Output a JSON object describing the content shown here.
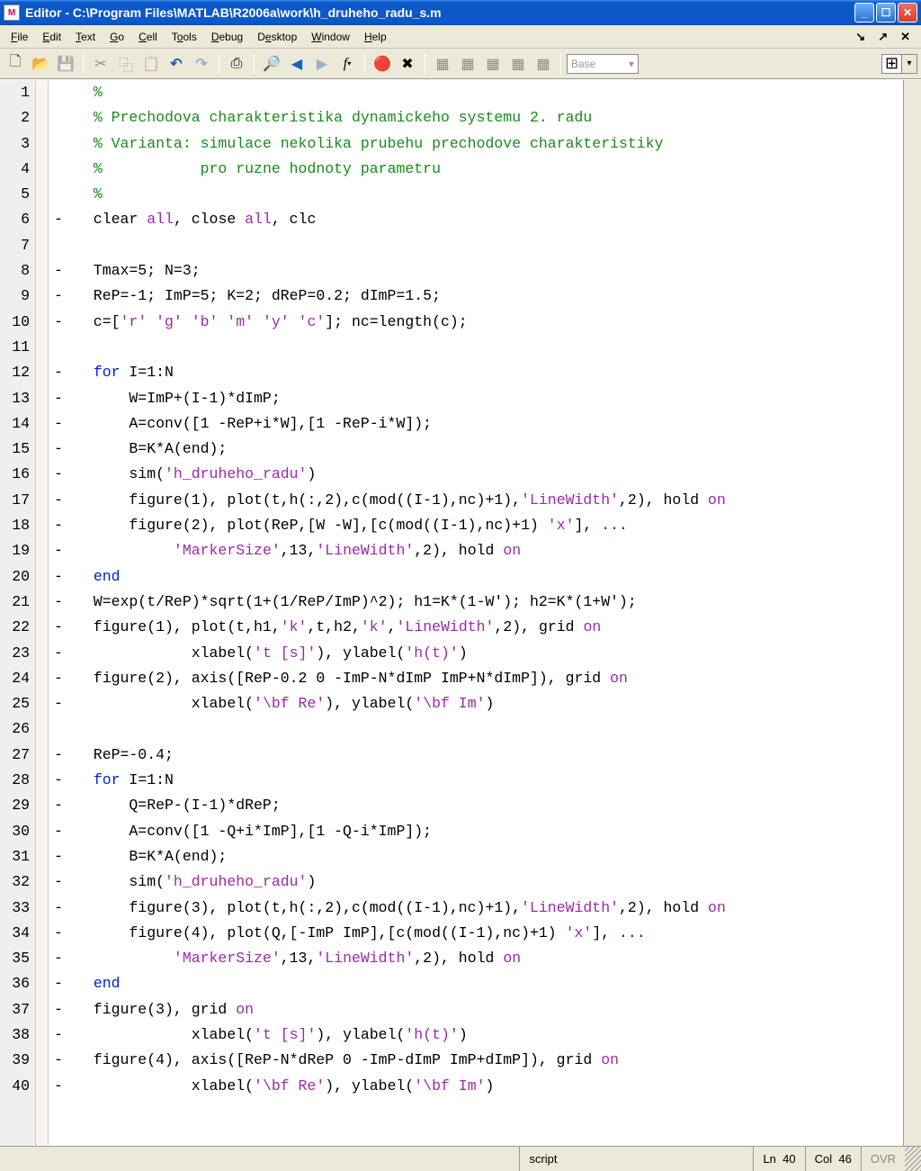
{
  "window": {
    "app_icon_label": "M",
    "title": "Editor - C:\\Program Files\\MATLAB\\R2006a\\work\\h_druheho_radu_s.m"
  },
  "menu": {
    "items": [
      "File",
      "Edit",
      "Text",
      "Go",
      "Cell",
      "Tools",
      "Debug",
      "Desktop",
      "Window",
      "Help"
    ],
    "mdi_min": "↘",
    "mdi_max": "⬈",
    "mdi_close": "✕"
  },
  "toolbar": {
    "base_label": "Base",
    "base_caret": "▾",
    "split_caret": "▾"
  },
  "editor": {
    "lines": [
      {
        "n": 1,
        "dash": "",
        "tokens": [
          {
            "t": "  ",
            "c": ""
          },
          {
            "t": "%",
            "c": "cm"
          }
        ]
      },
      {
        "n": 2,
        "dash": "",
        "tokens": [
          {
            "t": "  ",
            "c": ""
          },
          {
            "t": "% Prechodova charakteristika dynamickeho systemu 2. radu",
            "c": "cm"
          }
        ]
      },
      {
        "n": 3,
        "dash": "",
        "tokens": [
          {
            "t": "  ",
            "c": ""
          },
          {
            "t": "% Varianta: simulace nekolika prubehu prechodove charakteristiky",
            "c": "cm"
          }
        ]
      },
      {
        "n": 4,
        "dash": "",
        "tokens": [
          {
            "t": "  ",
            "c": ""
          },
          {
            "t": "%           pro ruzne hodnoty parametru",
            "c": "cm"
          }
        ]
      },
      {
        "n": 5,
        "dash": "",
        "tokens": [
          {
            "t": "  ",
            "c": ""
          },
          {
            "t": "%",
            "c": "cm"
          }
        ]
      },
      {
        "n": 6,
        "dash": "-",
        "tokens": [
          {
            "t": "  clear ",
            "c": ""
          },
          {
            "t": "all",
            "c": "st"
          },
          {
            "t": ", close ",
            "c": ""
          },
          {
            "t": "all",
            "c": "st"
          },
          {
            "t": ", clc",
            "c": ""
          }
        ]
      },
      {
        "n": 7,
        "dash": "",
        "tokens": [
          {
            "t": "",
            "c": ""
          }
        ]
      },
      {
        "n": 8,
        "dash": "-",
        "tokens": [
          {
            "t": "  Tmax=5; N=3;",
            "c": ""
          }
        ]
      },
      {
        "n": 9,
        "dash": "-",
        "tokens": [
          {
            "t": "  ReP=-1; ImP=5; K=2; dReP=0.2; dImP=1.5;",
            "c": ""
          }
        ]
      },
      {
        "n": 10,
        "dash": "-",
        "tokens": [
          {
            "t": "  c=[",
            "c": ""
          },
          {
            "t": "'r' 'g' 'b' 'm' 'y' 'c'",
            "c": "st"
          },
          {
            "t": "]; nc=length(c);",
            "c": ""
          }
        ]
      },
      {
        "n": 11,
        "dash": "",
        "tokens": [
          {
            "t": "",
            "c": ""
          }
        ]
      },
      {
        "n": 12,
        "dash": "-",
        "tokens": [
          {
            "t": "  ",
            "c": ""
          },
          {
            "t": "for",
            "c": "kw"
          },
          {
            "t": " I=1:N",
            "c": ""
          }
        ]
      },
      {
        "n": 13,
        "dash": "-",
        "tokens": [
          {
            "t": "      W=ImP+(I-1)*dImP;",
            "c": ""
          }
        ]
      },
      {
        "n": 14,
        "dash": "-",
        "tokens": [
          {
            "t": "      A=conv([1 -ReP+i*W],[1 -ReP-i*W]);",
            "c": ""
          }
        ]
      },
      {
        "n": 15,
        "dash": "-",
        "tokens": [
          {
            "t": "      B=K*A(end);",
            "c": ""
          }
        ]
      },
      {
        "n": 16,
        "dash": "-",
        "tokens": [
          {
            "t": "      sim(",
            "c": ""
          },
          {
            "t": "'h_druheho_radu'",
            "c": "st"
          },
          {
            "t": ")",
            "c": ""
          }
        ]
      },
      {
        "n": 17,
        "dash": "-",
        "tokens": [
          {
            "t": "      figure(1), plot(t,h(:,2),c(mod((I-1),nc)+1),",
            "c": ""
          },
          {
            "t": "'LineWidth'",
            "c": "st"
          },
          {
            "t": ",2), hold ",
            "c": ""
          },
          {
            "t": "on",
            "c": "st"
          }
        ]
      },
      {
        "n": 18,
        "dash": "-",
        "tokens": [
          {
            "t": "      figure(2), plot(ReP,[W -W],[c(mod((I-1),nc)+1) ",
            "c": ""
          },
          {
            "t": "'x'",
            "c": "st"
          },
          {
            "t": "], ",
            "c": ""
          },
          {
            "t": "...",
            "c": "kw"
          }
        ]
      },
      {
        "n": 19,
        "dash": "-",
        "tokens": [
          {
            "t": "           ",
            "c": ""
          },
          {
            "t": "'MarkerSize'",
            "c": "st"
          },
          {
            "t": ",13,",
            "c": ""
          },
          {
            "t": "'LineWidth'",
            "c": "st"
          },
          {
            "t": ",2), hold ",
            "c": ""
          },
          {
            "t": "on",
            "c": "st"
          }
        ]
      },
      {
        "n": 20,
        "dash": "-",
        "tokens": [
          {
            "t": "  ",
            "c": ""
          },
          {
            "t": "end",
            "c": "kw"
          }
        ]
      },
      {
        "n": 21,
        "dash": "-",
        "tokens": [
          {
            "t": "  W=exp(t/ReP)*sqrt(1+(1/ReP/ImP)^2); h1=K*(1-W'); h2=K*(1+W');",
            "c": ""
          }
        ]
      },
      {
        "n": 22,
        "dash": "-",
        "tokens": [
          {
            "t": "  figure(1), plot(t,h1,",
            "c": ""
          },
          {
            "t": "'k'",
            "c": "st"
          },
          {
            "t": ",t,h2,",
            "c": ""
          },
          {
            "t": "'k'",
            "c": "st"
          },
          {
            "t": ",",
            "c": ""
          },
          {
            "t": "'LineWidth'",
            "c": "st"
          },
          {
            "t": ",2), grid ",
            "c": ""
          },
          {
            "t": "on",
            "c": "st"
          }
        ]
      },
      {
        "n": 23,
        "dash": "-",
        "tokens": [
          {
            "t": "             xlabel(",
            "c": ""
          },
          {
            "t": "'t [s]'",
            "c": "st"
          },
          {
            "t": "), ylabel(",
            "c": ""
          },
          {
            "t": "'h(t)'",
            "c": "st"
          },
          {
            "t": ")",
            "c": ""
          }
        ]
      },
      {
        "n": 24,
        "dash": "-",
        "tokens": [
          {
            "t": "  figure(2), axis([ReP-0.2 0 -ImP-N*dImP ImP+N*dImP]), grid ",
            "c": ""
          },
          {
            "t": "on",
            "c": "st"
          }
        ]
      },
      {
        "n": 25,
        "dash": "-",
        "tokens": [
          {
            "t": "             xlabel(",
            "c": ""
          },
          {
            "t": "'\\bf Re'",
            "c": "st"
          },
          {
            "t": "), ylabel(",
            "c": ""
          },
          {
            "t": "'\\bf Im'",
            "c": "st"
          },
          {
            "t": ")",
            "c": ""
          }
        ]
      },
      {
        "n": 26,
        "dash": "",
        "tokens": [
          {
            "t": "",
            "c": ""
          }
        ]
      },
      {
        "n": 27,
        "dash": "-",
        "tokens": [
          {
            "t": "  ReP=-0.4;",
            "c": ""
          }
        ]
      },
      {
        "n": 28,
        "dash": "-",
        "tokens": [
          {
            "t": "  ",
            "c": ""
          },
          {
            "t": "for",
            "c": "kw"
          },
          {
            "t": " I=1:N",
            "c": ""
          }
        ]
      },
      {
        "n": 29,
        "dash": "-",
        "tokens": [
          {
            "t": "      Q=ReP-(I-1)*dReP;",
            "c": ""
          }
        ]
      },
      {
        "n": 30,
        "dash": "-",
        "tokens": [
          {
            "t": "      A=conv([1 -Q+i*ImP],[1 -Q-i*ImP]);",
            "c": ""
          }
        ]
      },
      {
        "n": 31,
        "dash": "-",
        "tokens": [
          {
            "t": "      B=K*A(end);",
            "c": ""
          }
        ]
      },
      {
        "n": 32,
        "dash": "-",
        "tokens": [
          {
            "t": "      sim(",
            "c": ""
          },
          {
            "t": "'h_druheho_radu'",
            "c": "st"
          },
          {
            "t": ")",
            "c": ""
          }
        ]
      },
      {
        "n": 33,
        "dash": "-",
        "tokens": [
          {
            "t": "      figure(3), plot(t,h(:,2),c(mod((I-1),nc)+1),",
            "c": ""
          },
          {
            "t": "'LineWidth'",
            "c": "st"
          },
          {
            "t": ",2), hold ",
            "c": ""
          },
          {
            "t": "on",
            "c": "st"
          }
        ]
      },
      {
        "n": 34,
        "dash": "-",
        "tokens": [
          {
            "t": "      figure(4), plot(Q,[-ImP ImP],[c(mod((I-1),nc)+1) ",
            "c": ""
          },
          {
            "t": "'x'",
            "c": "st"
          },
          {
            "t": "], ",
            "c": ""
          },
          {
            "t": "...",
            "c": "kw"
          }
        ]
      },
      {
        "n": 35,
        "dash": "-",
        "tokens": [
          {
            "t": "           ",
            "c": ""
          },
          {
            "t": "'MarkerSize'",
            "c": "st"
          },
          {
            "t": ",13,",
            "c": ""
          },
          {
            "t": "'LineWidth'",
            "c": "st"
          },
          {
            "t": ",2), hold ",
            "c": ""
          },
          {
            "t": "on",
            "c": "st"
          }
        ]
      },
      {
        "n": 36,
        "dash": "-",
        "tokens": [
          {
            "t": "  ",
            "c": ""
          },
          {
            "t": "end",
            "c": "kw"
          }
        ]
      },
      {
        "n": 37,
        "dash": "-",
        "tokens": [
          {
            "t": "  figure(3), grid ",
            "c": ""
          },
          {
            "t": "on",
            "c": "st"
          }
        ]
      },
      {
        "n": 38,
        "dash": "-",
        "tokens": [
          {
            "t": "             xlabel(",
            "c": ""
          },
          {
            "t": "'t [s]'",
            "c": "st"
          },
          {
            "t": "), ylabel(",
            "c": ""
          },
          {
            "t": "'h(t)'",
            "c": "st"
          },
          {
            "t": ")",
            "c": ""
          }
        ]
      },
      {
        "n": 39,
        "dash": "-",
        "tokens": [
          {
            "t": "  figure(4), axis([ReP-N*dReP 0 -ImP-dImP ImP+dImP]), grid ",
            "c": ""
          },
          {
            "t": "on",
            "c": "st"
          }
        ]
      },
      {
        "n": 40,
        "dash": "-",
        "tokens": [
          {
            "t": "             xlabel(",
            "c": ""
          },
          {
            "t": "'\\bf Re'",
            "c": "st"
          },
          {
            "t": "), ylabel(",
            "c": ""
          },
          {
            "t": "'\\bf Im'",
            "c": "st"
          },
          {
            "t": ")",
            "c": ""
          }
        ]
      }
    ]
  },
  "status": {
    "type": "script",
    "ln_label": "Ln",
    "ln": "40",
    "col_label": "Col",
    "col": "46",
    "ovr": "OVR"
  }
}
